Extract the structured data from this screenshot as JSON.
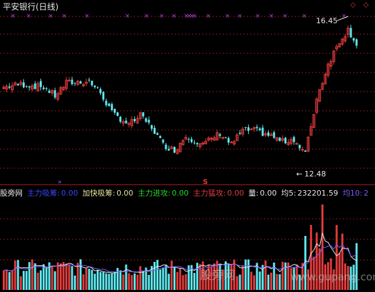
{
  "window": {
    "title": "平安银行(日线)"
  },
  "price_panel": {
    "high_label": "16.45",
    "low_label": "12.48",
    "high_arrow": "←",
    "low_arrow": "←",
    "sell_marker": "S",
    "buy_marker": "»",
    "y_range": [
      11.4,
      17.2
    ]
  },
  "indicator_bar": {
    "name": "股旁网",
    "items": [
      {
        "label": "主力吸筹:",
        "value": "0.00",
        "color": "#3a46ff"
      },
      {
        "label": "加快吸筹:",
        "value": "0.00",
        "color": "#e8e8a0"
      },
      {
        "label": "主力进攻:",
        "value": "0.00",
        "color": "#2bd52b"
      },
      {
        "label": "主力猛攻:",
        "value": "0.00",
        "color": "#e33a3a"
      },
      {
        "label": "量:",
        "value": "0.00",
        "color": "#e8e8e8"
      },
      {
        "label": "均5:",
        "value": "232201.59",
        "color": "#e8e8e8"
      },
      {
        "label": "均10:",
        "value": "2",
        "color": "#7b5cff"
      }
    ]
  },
  "watermark": {
    "text": "股旁网",
    "url": "www.gupang.com"
  },
  "colors": {
    "up": "#e23b3b",
    "down": "#5ee7ee",
    "grid": "#8a1a1a",
    "marker_x": "#c040e0",
    "ma5": "#e8e8e8",
    "ma10": "#7b5cff"
  }
}
